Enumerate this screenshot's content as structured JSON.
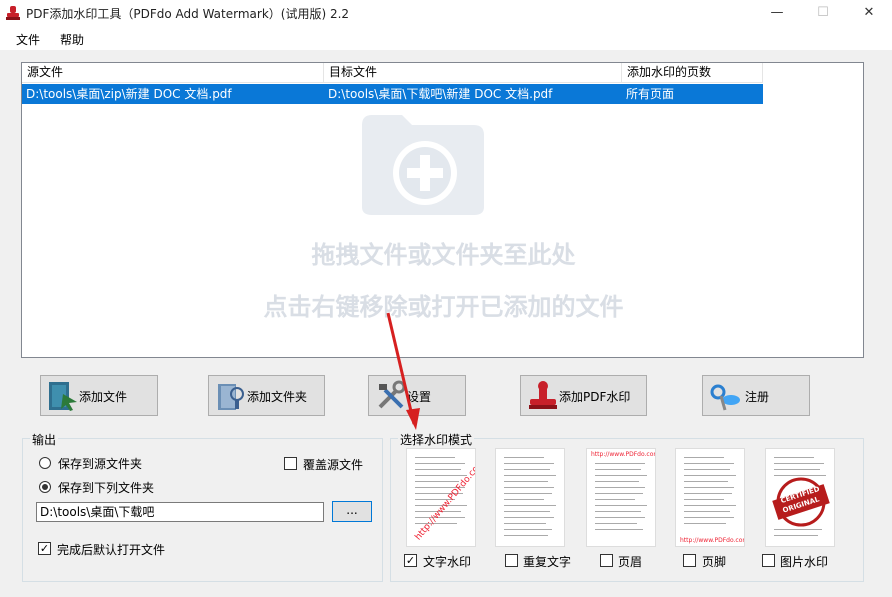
{
  "window": {
    "title": "PDF添加水印工具（PDFdo Add Watermark）(试用版) 2.2",
    "minimize": "—",
    "maximize": "☐",
    "close": "✕"
  },
  "menu": {
    "file": "文件",
    "help": "帮助"
  },
  "list": {
    "columns": [
      "源文件",
      "目标文件",
      "添加水印的页数"
    ],
    "rows": [
      {
        "source": "D:\\tools\\桌面\\zip\\新建 DOC 文档.pdf",
        "target": "D:\\tools\\桌面\\下载吧\\新建 DOC 文档.pdf",
        "pages": "所有页面"
      }
    ],
    "hint_line1": "拖拽文件或文件夹至此处",
    "hint_line2": "点击右键移除或打开已添加的文件"
  },
  "toolbar": {
    "add_file": "添加文件",
    "add_folder": "添加文件夹",
    "settings": "设置",
    "add_watermark": "添加PDF水印",
    "register": "注册"
  },
  "output": {
    "title": "输出",
    "save_to_source": "保存到源文件夹",
    "save_to_folder": "保存到下列文件夹",
    "overwrite": "覆盖源文件",
    "path": "D:\\tools\\桌面\\下载吧",
    "browse": "...",
    "open_after": "完成后默认打开文件",
    "selected_mode": "save_to_folder",
    "overwrite_checked": false,
    "open_after_checked": true
  },
  "watermark_mode": {
    "title": "选择水印模式",
    "options": [
      {
        "label": "文字水印",
        "checked": true
      },
      {
        "label": "重复文字",
        "checked": false
      },
      {
        "label": "页眉",
        "checked": false
      },
      {
        "label": "页脚",
        "checked": false
      },
      {
        "label": "图片水印",
        "checked": false
      }
    ],
    "thumb_text": "http://www.PDFdo.com",
    "stamp_line1": "CERTIFIED",
    "stamp_line2": "ORIGINAL"
  },
  "colors": {
    "selection": "#0a78d7",
    "accent_red": "#d9232e"
  }
}
